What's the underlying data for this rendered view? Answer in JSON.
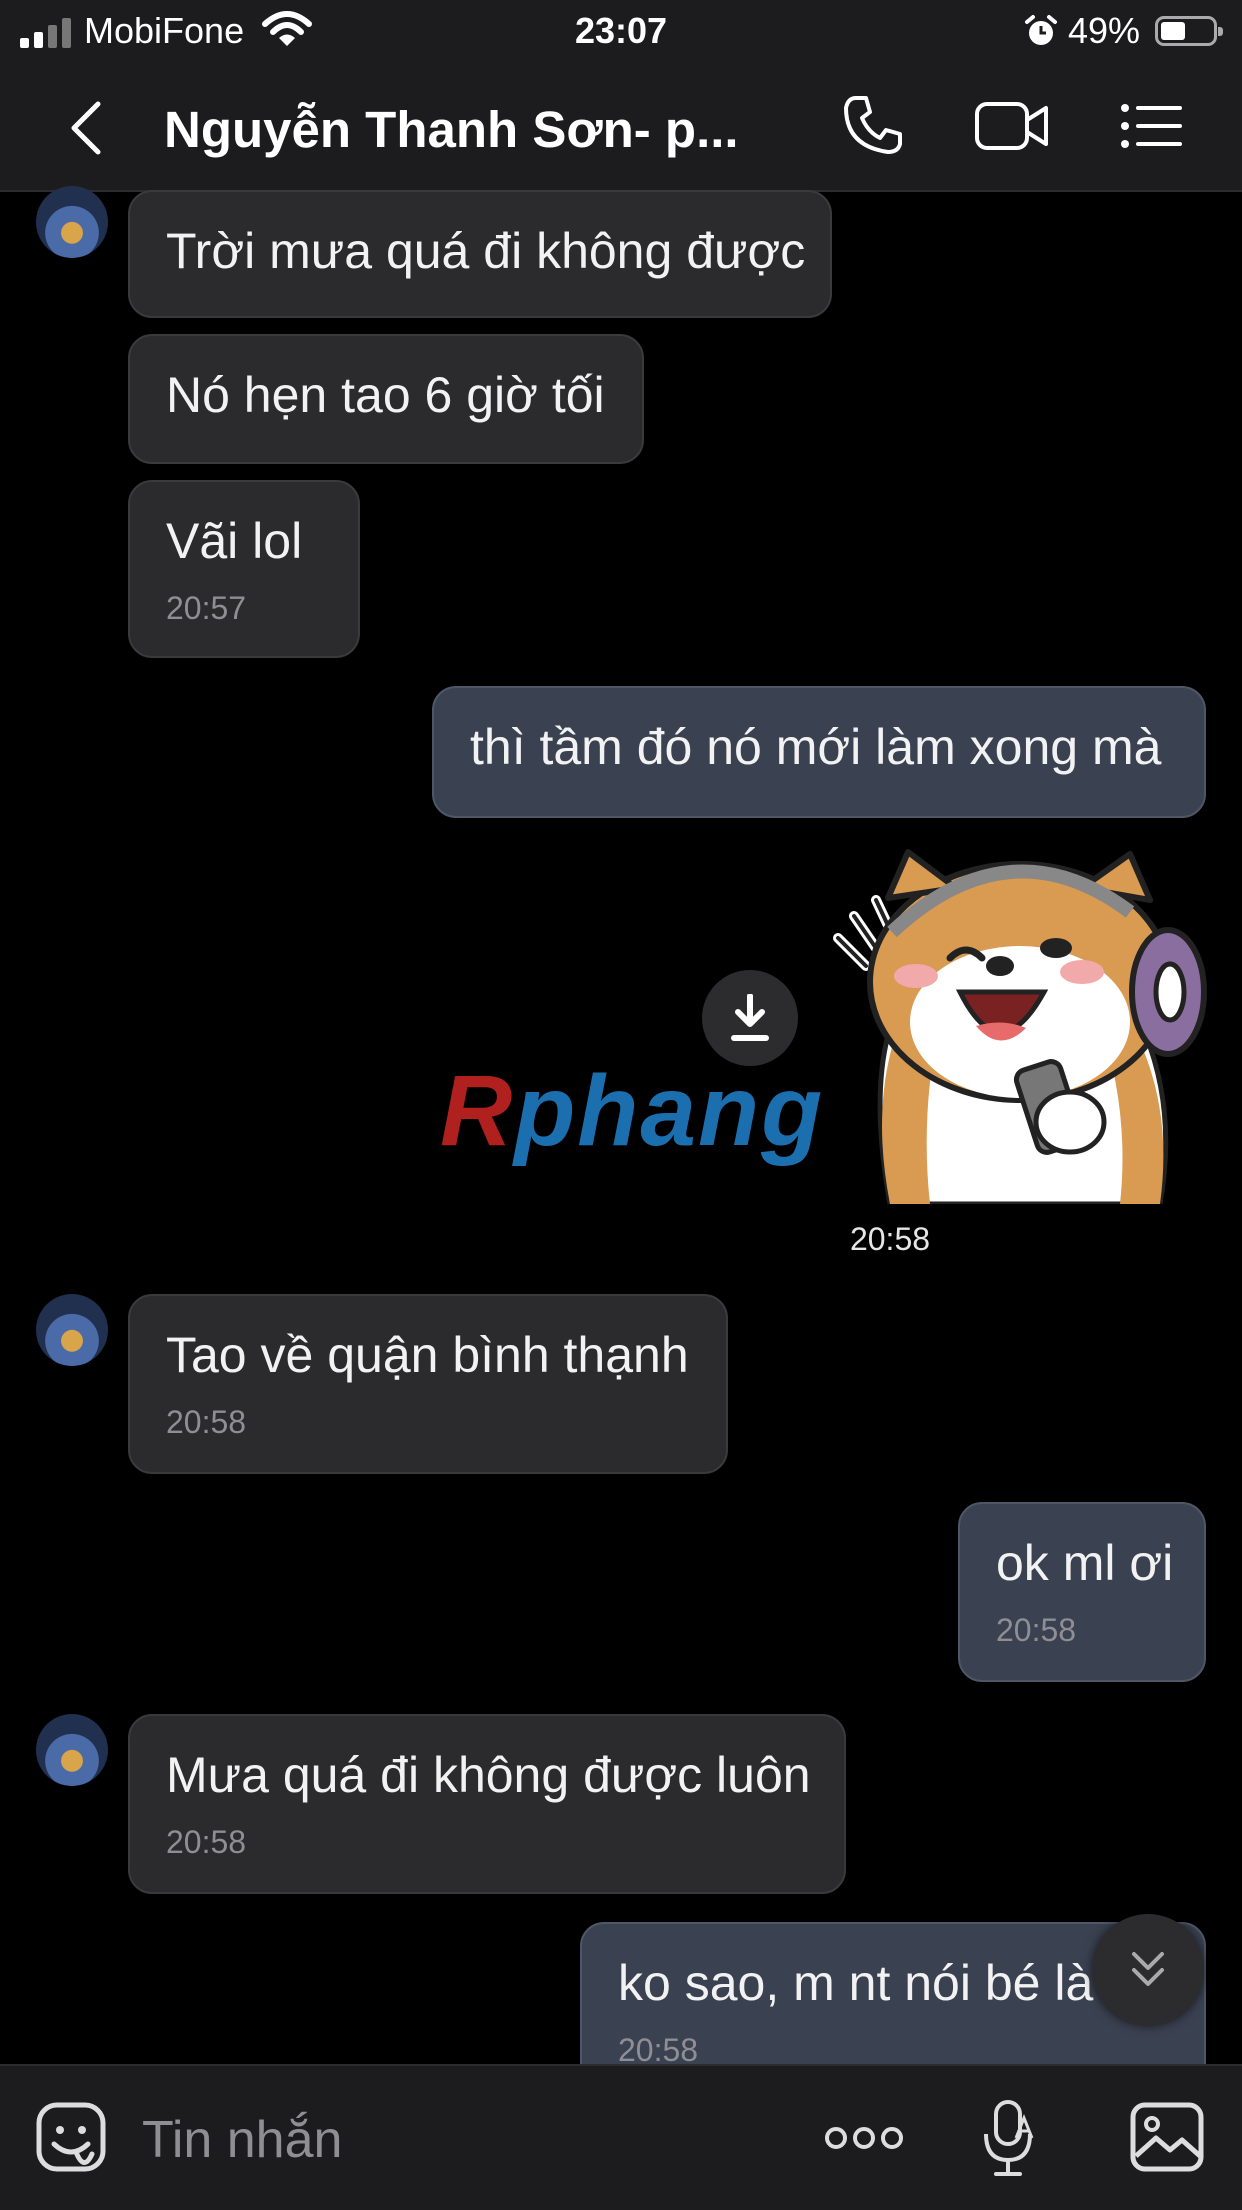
{
  "status_bar": {
    "carrier": "MobiFone",
    "time": "23:07",
    "battery": "49%",
    "battery_level": 0.49
  },
  "header": {
    "title": "Nguyễn Thanh Sơn- p..."
  },
  "messages": [
    {
      "dir": "in",
      "text": "Trời mưa quá đi không được",
      "time": ""
    },
    {
      "dir": "in",
      "text": "Nó hẹn tao 6 giờ tối",
      "time": ""
    },
    {
      "dir": "in",
      "text": "Vãi lol",
      "time": "20:57"
    },
    {
      "dir": "out",
      "text": "thì tầm đó nó mới làm xong mà",
      "time": ""
    },
    {
      "dir": "out",
      "type": "sticker",
      "sticker": "shiba-dog-headphones-sticker",
      "time": "20:58"
    },
    {
      "dir": "in",
      "text": "Tao về quận bình thạnh",
      "time": "20:58"
    },
    {
      "dir": "out",
      "text": "ok ml ơi",
      "time": "20:58"
    },
    {
      "dir": "in",
      "text": "Mưa quá đi không được luôn",
      "time": "20:58"
    },
    {
      "dir": "out",
      "text": "ko sao, m nt nói bé là",
      "time": "20:58"
    }
  ],
  "watermark": {
    "part1": "R",
    "part2": "phang"
  },
  "input": {
    "placeholder": "Tin nhắn"
  },
  "colors": {
    "background": "#000000",
    "bar": "#1c1c1e",
    "bubble_in": "#2b2b2d",
    "bubble_out": "#3a4150"
  }
}
